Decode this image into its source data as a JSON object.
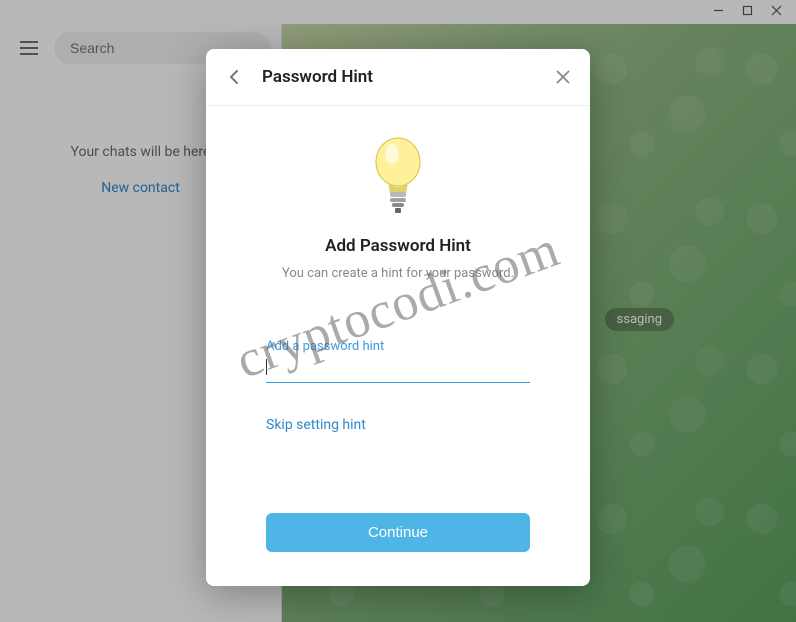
{
  "window": {
    "minimize": "—",
    "maximize": "▢",
    "close": "✕"
  },
  "sidebar": {
    "search_placeholder": "Search",
    "chats_placeholder": "Your chats will be here",
    "new_contact": "New contact"
  },
  "chat": {
    "badge": "ssaging"
  },
  "dialog": {
    "title": "Password Hint",
    "section_title": "Add Password Hint",
    "section_sub": "You can create a hint for your password.",
    "field_label": "Add a password hint",
    "field_value": "",
    "skip": "Skip setting hint",
    "continue": "Continue"
  },
  "watermark": "cryptocodi.com"
}
